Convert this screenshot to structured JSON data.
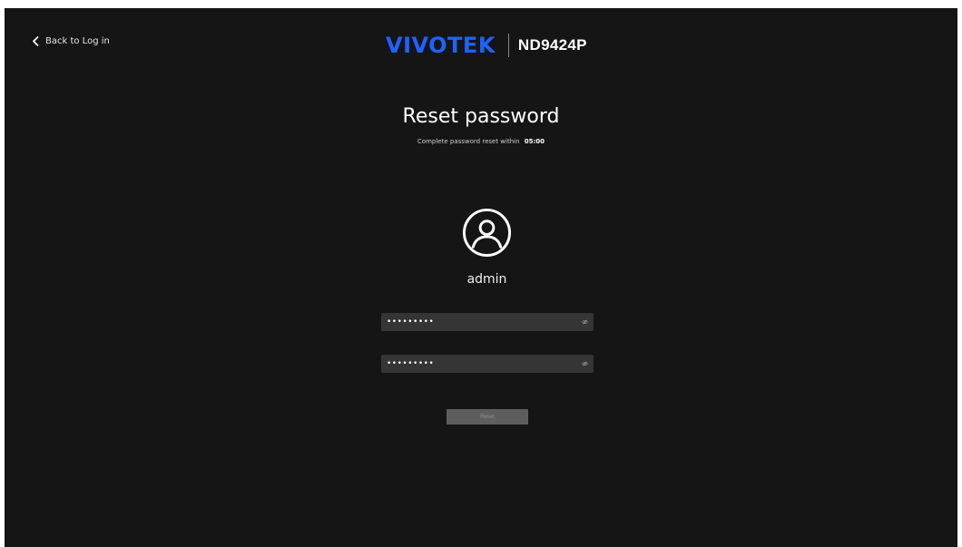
{
  "nav": {
    "back_label": "Back to Log in"
  },
  "brand": {
    "logo": "VIVOTEK",
    "model": "ND9424P",
    "accent": "#1f62ff"
  },
  "page": {
    "title": "Reset password",
    "subtitle": "Complete password reset within",
    "timer": "05:00"
  },
  "user": {
    "name": "admin",
    "icon": "user-circle-icon"
  },
  "form": {
    "password_value": "•••••••••",
    "confirm_value": "•••••••••",
    "toggle_icon": "eye-slash-icon",
    "reset_label": "Reset"
  },
  "colors": {
    "background": "#151515",
    "field": "#353535",
    "button_disabled": "#5e5e5e"
  }
}
